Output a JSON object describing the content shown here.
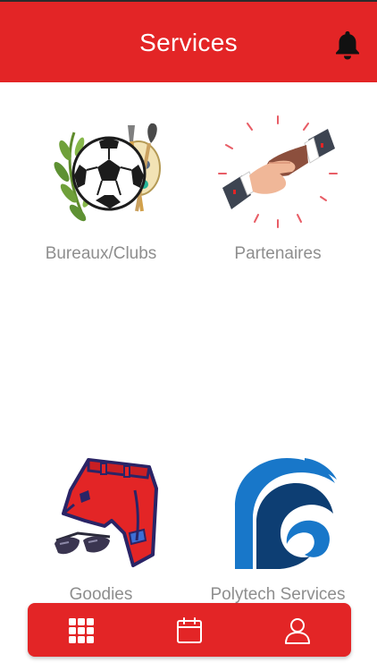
{
  "header": {
    "title": "Services",
    "bell_icon": "bell-icon"
  },
  "services": [
    {
      "label": "Bureaux/Clubs",
      "icon": "clubs-sports-arts-icon"
    },
    {
      "label": "Partenaires",
      "icon": "handshake-icon"
    },
    {
      "label": "Goodies",
      "icon": "goodies-clothing-icon"
    },
    {
      "label": "Polytech Services",
      "icon": "wave-logo-icon"
    }
  ],
  "bottom_nav": {
    "items": [
      {
        "icon": "grid-icon",
        "active": true
      },
      {
        "icon": "calendar-icon",
        "active": false
      },
      {
        "icon": "user-icon",
        "active": false
      }
    ]
  },
  "colors": {
    "primary": "#e32526",
    "label_gray": "#8e8e8e",
    "background": "#ffffff",
    "logo_blue": "#1877c9",
    "logo_navy": "#0d3e73"
  }
}
